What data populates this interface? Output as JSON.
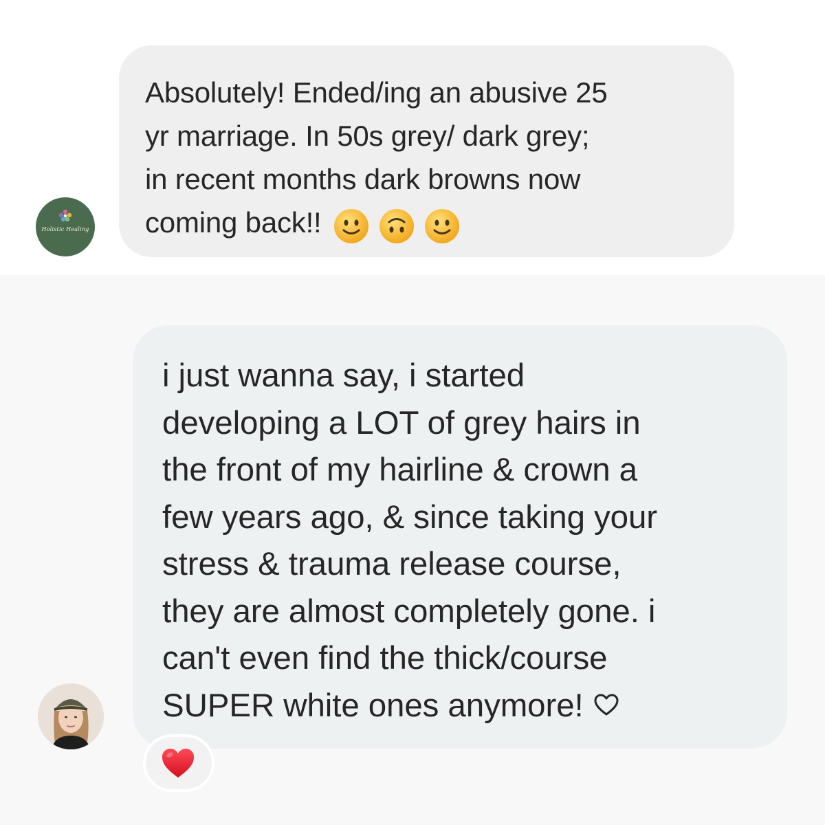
{
  "thread": {
    "message_1": {
      "lines": [
        "Absolutely! Ended/ing an abusive 25",
        "yr marriage. In 50s grey/ dark grey;",
        "in recent months dark browns now",
        "coming back!!"
      ],
      "emojis": [
        "slightly-smiling-face-icon",
        "upside-down-face-icon",
        "slightly-smiling-face-icon"
      ]
    },
    "message_2": {
      "lines": [
        "i just wanna say, i started",
        "developing a LOT of grey hairs in",
        "the front of my hairline & crown a",
        "few years ago, & since taking your",
        "stress & trauma release course,",
        "they are almost completely gone. i",
        "can't even find the thick/course",
        "SUPER white ones anymore!"
      ],
      "trailing_icon": "heart-outline-icon",
      "reaction": "red-heart-icon"
    },
    "avatar_1": {
      "icon": "holistic-healing-logo",
      "script_text": "Holistic Healing",
      "bg_color": "#4a6b4d"
    },
    "avatar_2": {
      "icon": "user-photo-avatar"
    },
    "colors": {
      "bubble_1": "#efefef",
      "bubble_2": "#eef1f2",
      "text": "#262626",
      "reaction_heart": "#e0182d",
      "emoji_face": "#f9c43f"
    }
  }
}
